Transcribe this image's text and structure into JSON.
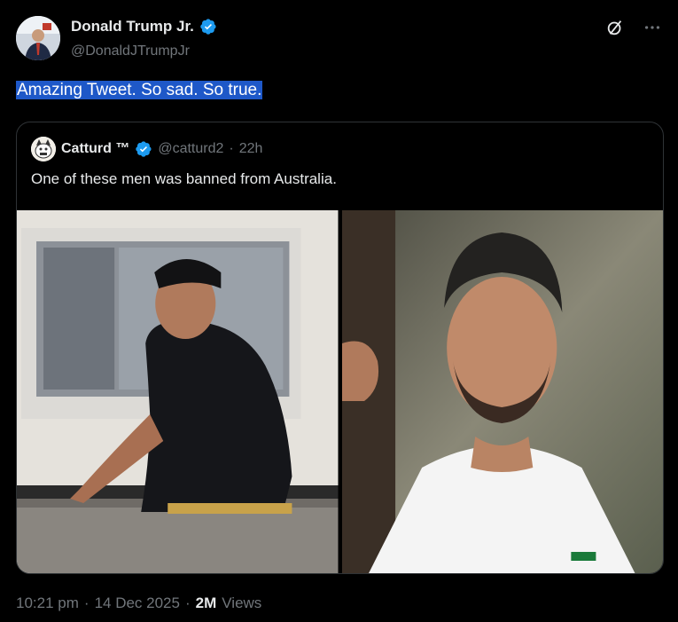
{
  "author": {
    "name": "Donald Trump Jr.",
    "handle": "@DonaldJTrumpJr"
  },
  "tweet": {
    "text": "Amazing Tweet. So sad. So true."
  },
  "quoted": {
    "name": "Catturd ™",
    "handle": "@catturd2",
    "separator": "·",
    "time": "22h",
    "text": "One of these men was banned from Australia."
  },
  "footer": {
    "time": "10:21 pm",
    "sep1": "·",
    "date": "14 Dec 2025",
    "sep2": "·",
    "views_count": "2M",
    "views_label": "Views"
  },
  "colors": {
    "verified": "#1d9bf0",
    "highlight": "#1e58c8",
    "muted": "#71767b"
  },
  "icons": [
    "verified-badge-icon",
    "grok-icon",
    "more-icon"
  ]
}
